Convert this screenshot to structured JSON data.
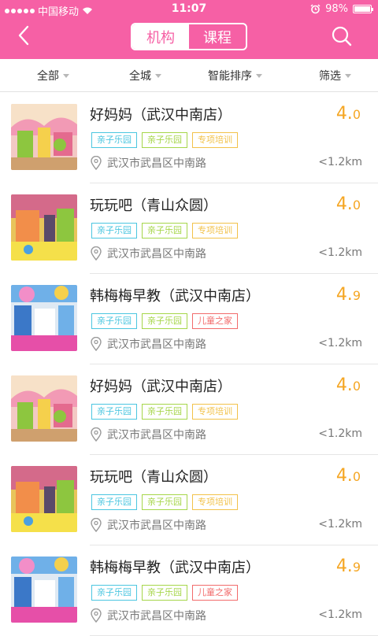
{
  "status_bar": {
    "carrier": "中国移动",
    "time": "11:07",
    "battery": "98%",
    "battery_level": 0.98
  },
  "header": {
    "tabs": [
      {
        "label": "机构",
        "active": true
      },
      {
        "label": "课程",
        "active": false
      }
    ]
  },
  "filters": [
    "全部",
    "全城",
    "智能排序",
    "筛选"
  ],
  "colors": {
    "brand": "#f660a5",
    "rating": "#f5a623"
  },
  "tag_styles": {
    "亲子乐园": {
      "color": "#4bc6e0"
    },
    "专项培训": {
      "color": "#f2c24a"
    },
    "儿童之家": {
      "color": "#f26b6b"
    }
  },
  "items": [
    {
      "name": "好妈妈（武汉中南店）",
      "rating_int": "4.",
      "rating_dec": "0",
      "tags": [
        {
          "text": "亲子乐园",
          "color": "#4bc6e0"
        },
        {
          "text": "亲子乐园",
          "color": "#a6d64a"
        },
        {
          "text": "专项培训",
          "color": "#f2c24a"
        }
      ],
      "address": "武汉市武昌区中南路",
      "distance": "<1.2km",
      "thumb": "playground-pink"
    },
    {
      "name": "玩玩吧（青山众圆）",
      "rating_int": "4.",
      "rating_dec": "0",
      "tags": [
        {
          "text": "亲子乐园",
          "color": "#4bc6e0"
        },
        {
          "text": "亲子乐园",
          "color": "#a6d64a"
        },
        {
          "text": "专项培训",
          "color": "#f2c24a"
        }
      ],
      "address": "武汉市武昌区中南路",
      "distance": "<1.2km",
      "thumb": "playground-yellow"
    },
    {
      "name": "韩梅梅早教（武汉中南店）",
      "rating_int": "4.",
      "rating_dec": "9",
      "tags": [
        {
          "text": "亲子乐园",
          "color": "#4bc6e0"
        },
        {
          "text": "亲子乐园",
          "color": "#a6d64a"
        },
        {
          "text": "儿童之家",
          "color": "#f26b6b"
        }
      ],
      "address": "武汉市武昌区中南路",
      "distance": "<1.2km",
      "thumb": "room-blue"
    },
    {
      "name": "好妈妈（武汉中南店）",
      "rating_int": "4.",
      "rating_dec": "0",
      "tags": [
        {
          "text": "亲子乐园",
          "color": "#4bc6e0"
        },
        {
          "text": "亲子乐园",
          "color": "#a6d64a"
        },
        {
          "text": "专项培训",
          "color": "#f2c24a"
        }
      ],
      "address": "武汉市武昌区中南路",
      "distance": "<1.2km",
      "thumb": "playground-pink"
    },
    {
      "name": "玩玩吧（青山众圆）",
      "rating_int": "4.",
      "rating_dec": "0",
      "tags": [
        {
          "text": "亲子乐园",
          "color": "#4bc6e0"
        },
        {
          "text": "亲子乐园",
          "color": "#a6d64a"
        },
        {
          "text": "专项培训",
          "color": "#f2c24a"
        }
      ],
      "address": "武汉市武昌区中南路",
      "distance": "<1.2km",
      "thumb": "playground-yellow"
    },
    {
      "name": "韩梅梅早教（武汉中南店）",
      "rating_int": "4.",
      "rating_dec": "9",
      "tags": [
        {
          "text": "亲子乐园",
          "color": "#4bc6e0"
        },
        {
          "text": "亲子乐园",
          "color": "#a6d64a"
        },
        {
          "text": "儿童之家",
          "color": "#f26b6b"
        }
      ],
      "address": "武汉市武昌区中南路",
      "distance": "<1.2km",
      "thumb": "room-blue"
    }
  ]
}
